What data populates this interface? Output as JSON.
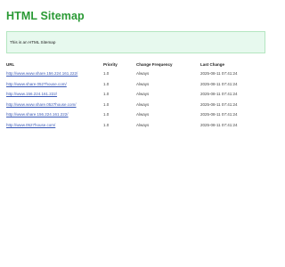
{
  "page": {
    "title": "HTML Sitemap",
    "notice": "This is an HTML Sitemap"
  },
  "table": {
    "headers": {
      "url": "URL",
      "priority": "Priority",
      "change_frequency": "Change Frequency",
      "last_change": "Last Change"
    },
    "rows": [
      {
        "url": "http://www.www.share.156.224.161.222/",
        "priority": "1.0",
        "change_frequency": "Always",
        "last_change": "2025-08-11 07:41:24"
      },
      {
        "url": "http://www.share.0527house.com/",
        "priority": "1.0",
        "change_frequency": "Always",
        "last_change": "2025-08-11 07:41:24"
      },
      {
        "url": "http://www.156.224.161.222/",
        "priority": "1.0",
        "change_frequency": "Always",
        "last_change": "2025-08-11 07:41:24"
      },
      {
        "url": "http://www.www.share.0527house.com/",
        "priority": "1.0",
        "change_frequency": "Always",
        "last_change": "2025-08-11 07:41:24"
      },
      {
        "url": "http://www.share.156.224.161.222/",
        "priority": "1.0",
        "change_frequency": "Always",
        "last_change": "2025-08-11 07:41:24"
      },
      {
        "url": "http://www.0527house.com/",
        "priority": "1.0",
        "change_frequency": "Always",
        "last_change": "2025-08-11 07:41:24"
      }
    ]
  },
  "colors": {
    "title": "#2a9a35",
    "notice_background": "#e7f9ee",
    "notice_border": "#b3e6c0",
    "link": "#3b5ab8"
  }
}
